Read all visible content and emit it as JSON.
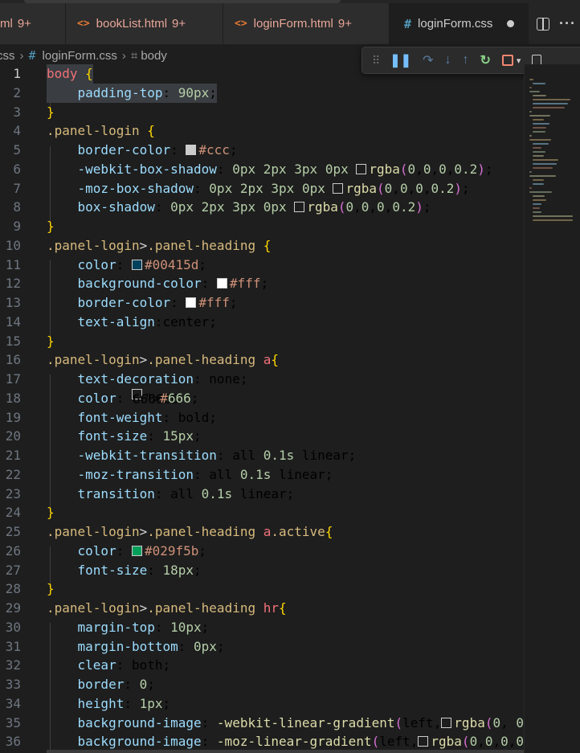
{
  "tabs": [
    {
      "icon": "‹›",
      "name": "ml",
      "count": "9+",
      "active": false
    },
    {
      "icon": "‹›",
      "name": "bookList.html",
      "count": "9+",
      "active": false
    },
    {
      "icon": "‹›",
      "name": "loginForm.html",
      "count": "9+",
      "active": false
    },
    {
      "icon": "#",
      "name": "loginForm.css",
      "count": "",
      "active": true
    }
  ],
  "breadcrumb": {
    "part0": "css",
    "file": "loginForm.css",
    "symbol": "body"
  },
  "code_lines": [
    "body {",
    "    padding-top: 90px;",
    "}",
    ".panel-login {",
    "    border-color: #ccc;",
    "    -webkit-box-shadow: 0px 2px 3px 0px rgba(0,0,0,0.2);",
    "    -moz-box-shadow: 0px 2px 3px 0px rgba(0,0,0,0.2);",
    "    box-shadow: 0px 2px 3px 0px rgba(0,0,0,0.2);",
    "}",
    ".panel-login>.panel-heading {",
    "    color: #00415d;",
    "    background-color: #fff;",
    "    border-color: #fff;",
    "    text-align:center;",
    "}",
    ".panel-login>.panel-heading a{",
    "    text-decoration: none;",
    "    color: #666;",
    "    font-weight: bold;",
    "    font-size: 15px;",
    "    -webkit-transition: all 0.1s linear;",
    "    -moz-transition: all 0.1s linear;",
    "    transition: all 0.1s linear;",
    "}",
    ".panel-login>.panel-heading a.active{",
    "    color: #029f5b;",
    "    font-size: 18px;",
    "}",
    ".panel-login>.panel-heading hr{",
    "    margin-top: 10px;",
    "    margin-bottom: 0px;",
    "    clear: both;",
    "    border: 0;",
    "    height: 1px;",
    "    background-image: -webkit-linear-gradient(left,rgba(0, 0",
    "    background-image: -moz-linear-gradient(left,rgba(0,0,0,0"
  ],
  "swatch_colors": {
    "ccc": "#cccccc",
    "shadow": "#1e1e1e",
    "c00415d": "#00415d",
    "fff": "#ffffff",
    "c666": "#666666",
    "c029f5b": "#029f5b"
  },
  "icons": {
    "split": "split-editor-icon",
    "more": "more-actions-icon",
    "pause": "pause-icon",
    "step_over": "step-over-icon",
    "step_into": "step-into-icon",
    "step_out": "step-out-icon",
    "restart": "restart-icon",
    "stop": "stop-icon"
  }
}
